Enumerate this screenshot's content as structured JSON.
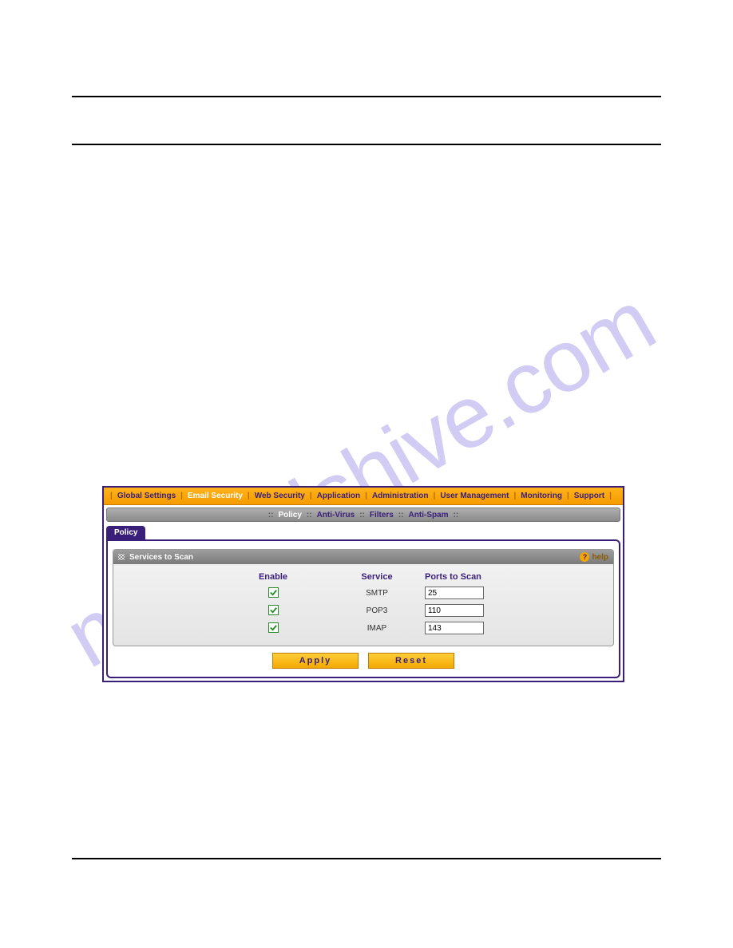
{
  "watermark": "manualshive.com",
  "topnav": {
    "items": [
      {
        "label": "Global Settings",
        "active": false
      },
      {
        "label": "Email Security",
        "active": true
      },
      {
        "label": "Web Security",
        "active": false
      },
      {
        "label": "Application",
        "active": false
      },
      {
        "label": "Administration",
        "active": false
      },
      {
        "label": "User Management",
        "active": false
      },
      {
        "label": "Monitoring",
        "active": false
      },
      {
        "label": "Support",
        "active": false
      }
    ]
  },
  "subnav": {
    "items": [
      {
        "label": "Policy",
        "active": true
      },
      {
        "label": "Anti-Virus",
        "active": false
      },
      {
        "label": "Filters",
        "active": false
      },
      {
        "label": "Anti-Spam",
        "active": false
      }
    ]
  },
  "tab": {
    "label": "Policy"
  },
  "section": {
    "title": "Services to Scan",
    "help_label": "help",
    "columns": {
      "enable": "Enable",
      "service": "Service",
      "ports": "Ports to Scan"
    },
    "rows": [
      {
        "enabled": true,
        "service": "SMTP",
        "port": "25"
      },
      {
        "enabled": true,
        "service": "POP3",
        "port": "110"
      },
      {
        "enabled": true,
        "service": "IMAP",
        "port": "143"
      }
    ]
  },
  "buttons": {
    "apply": "Apply",
    "reset": "Reset"
  }
}
